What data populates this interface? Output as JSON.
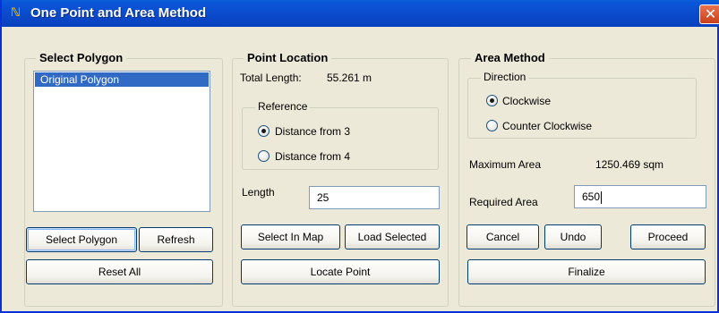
{
  "window": {
    "title": "One Point and Area Method",
    "icon": "app-logo-icon",
    "close_glyph": "✕"
  },
  "select_polygon": {
    "title": "Select Polygon",
    "list_items": [
      "Original Polygon"
    ],
    "select_button": "Select Polygon",
    "refresh_button": "Refresh",
    "reset_button": "Reset All"
  },
  "point_location": {
    "title": "Point Location",
    "total_length_label": "Total Length:",
    "total_length_value": "55.261 m",
    "reference_title": "Reference",
    "ref_option_1": "Distance from 3",
    "ref_option_2": "Distance from 4",
    "selected_reference": "Distance from 3",
    "length_label": "Length",
    "length_value": "25",
    "select_in_map_button": "Select In Map",
    "load_selected_button": "Load Selected",
    "locate_point_button": "Locate Point"
  },
  "area_method": {
    "title": "Area Method",
    "direction_title": "Direction",
    "dir_option_1": "Clockwise",
    "dir_option_2": "Counter Clockwise",
    "selected_direction": "Clockwise",
    "max_area_label": "Maximum Area",
    "max_area_value": "1250.469 sqm",
    "required_area_label": "Required Area",
    "required_area_value": "650",
    "cancel_button": "Cancel",
    "undo_button": "Undo",
    "proceed_button": "Proceed",
    "finalize_button": "Finalize"
  },
  "colors": {
    "titlebar": "#0a54d8",
    "selection": "#316ac5",
    "dialog_bg": "#ece9d8",
    "close_button": "#d9562b"
  }
}
